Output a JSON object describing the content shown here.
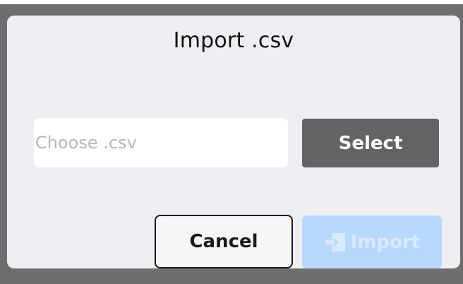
{
  "dialog": {
    "title": "Import .csv",
    "file_input": {
      "value": "",
      "placeholder": "Choose .csv"
    },
    "select_label": "Select",
    "cancel_label": "Cancel",
    "import_label": "Import",
    "import_icon": "import-arrow-icon",
    "import_disabled": true
  },
  "colors": {
    "frame": "#6e6e6e",
    "dialog_bg": "#efeef2",
    "select_bg": "#636363",
    "import_bg_disabled": "#b8d8fb",
    "placeholder": "#b8b8bc"
  }
}
